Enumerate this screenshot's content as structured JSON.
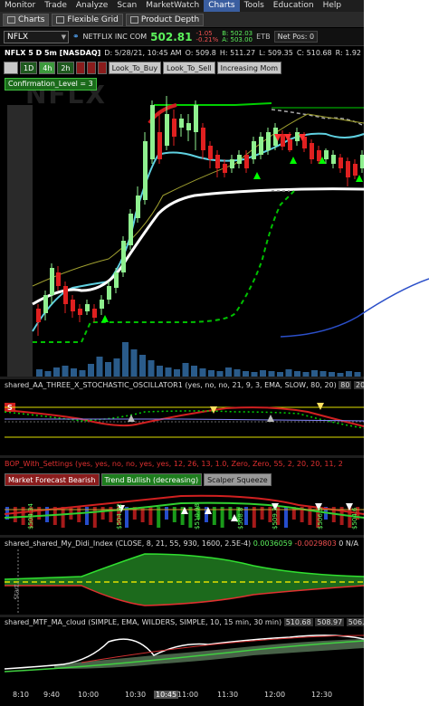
{
  "menu": [
    "Monitor",
    "Trade",
    "Analyze",
    "Scan",
    "MarketWatch",
    "Charts",
    "Tools",
    "Education",
    "Help"
  ],
  "menu_active": "Charts",
  "toolbar": {
    "charts": "Charts",
    "flexible_grid": "Flexible Grid",
    "product_depth": "Product Depth"
  },
  "quote": {
    "symbol": "NFLX",
    "name": "NETFLIX INC COM",
    "price": "502.81",
    "change": "-1.05",
    "change_pct": "-0.21%",
    "bid": "B: 502.03",
    "ask": "A: 503.00",
    "etb": "ETB",
    "net_pos": "Net Pos: 0"
  },
  "info": {
    "ticker": "NFLX 5 D 5m [NASDAQ]",
    "date": "D: 5/28/21, 10:45 AM",
    "open": "O: 509.8",
    "high": "H: 511.27",
    "low": "L: 509.35",
    "close": "C: 510.68",
    "range": "R: 1.92"
  },
  "buttons": {
    "b1d": "1D",
    "b4h": "4h",
    "b2h": "2h",
    "look_buy": "Look_To_Buy",
    "look_sell": "Look_To_Sell",
    "increasing": "Increasing Mom"
  },
  "confirmation": "Confirmation_Level = 3",
  "watermark": "NFLX",
  "study1": "shared_AA_THREE_X_STOCHASTIC_OSCILLATOR1 (yes, no, no, 21, 9, 3, EMA, SLOW, 80, 20)",
  "study1_vals": {
    "a": "80",
    "b": "20"
  },
  "study1_badge": "S",
  "study2": "BOP_With_Settings (yes, yes, no, no, yes, yes, 12, 26, 13, 1.0, Zero, Zero, 55, 2, 20, 20, 11, 2",
  "study2_badges": {
    "bearish": "Market Forecast Bearish",
    "bullish": "Trend Bullish (decreasing)",
    "squeeze": "Scalper Squeeze"
  },
  "study2_prices": [
    "$504.34",
    "$504.82",
    "$510.98",
    "$508.8",
    "$509.3",
    "$506.3",
    "$504.6"
  ],
  "study3": "shared_shared_My_Didi_Index (CLOSE, 8, 21, 55, 930, 1600, 2.5E-4)",
  "study3_vals": {
    "v1": "0.0036059",
    "v2": "-0.0029803",
    "v3": "0",
    "na": "N/A"
  },
  "study3_start": "Start",
  "study4": "shared_MTF_MA_cloud (SIMPLE, EMA, WILDERS, SIMPLE, 10, 15 min, 30 min)",
  "study4_vals": {
    "v1": "510.68",
    "v2": "508.97",
    "v3": "506."
  },
  "time_labels": [
    "8:10",
    "9:40",
    "10:00",
    "10:30",
    "10:45",
    "11:00",
    "11:30",
    "12:00",
    "12:30"
  ],
  "time_highlight": "10:45",
  "colors": {
    "bg": "#000000",
    "up": "#8ff08f",
    "down": "#e02020",
    "accent_green": "#00c000",
    "ema": "#5fd0e0",
    "annotation": "#2b4fc9"
  }
}
